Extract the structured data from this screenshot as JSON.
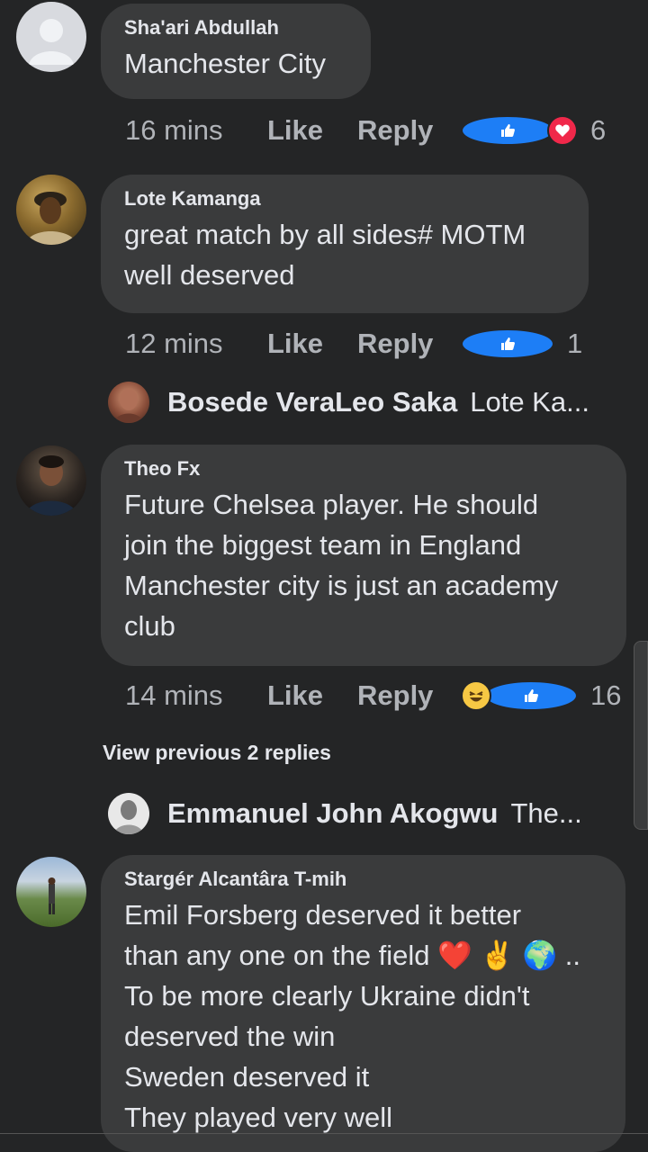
{
  "comments": [
    {
      "author": "Sha'ari Abdullah",
      "text_lines": [
        "Manchester City"
      ],
      "time": "16 mins",
      "like_label": "Like",
      "reply_label": "Reply",
      "reactions": [
        "like-icon",
        "love-icon"
      ],
      "reaction_count": "6"
    },
    {
      "author": "Lote Kamanga",
      "text_lines": [
        "great match by all sides# MOTM",
        "well deserved"
      ],
      "time": "12 mins",
      "like_label": "Like",
      "reply_label": "Reply",
      "reactions": [
        "like-icon"
      ],
      "reaction_count": "1",
      "reply_preview": {
        "author": "Bosede VeraLeo Saka",
        "text": "Lote Ka..."
      }
    },
    {
      "author": "Theo Fx",
      "text_lines": [
        "Future Chelsea player. He should",
        "join the biggest team in England",
        "Manchester city is just an academy",
        "club"
      ],
      "time": "14 mins",
      "like_label": "Like",
      "reply_label": "Reply",
      "reactions": [
        "haha-icon",
        "like-icon"
      ],
      "reaction_count": "16",
      "view_previous": "View previous 2 replies",
      "reply_preview": {
        "author": "Emmanuel John Akogwu",
        "text": "The..."
      }
    },
    {
      "author": "Stargér Alcantâra T-mih",
      "text_lines": [
        "Emil Forsberg deserved it better",
        "than any one on the field ❤️ ✌️ 🌍 ..",
        "To be more clearly Ukraine didn't",
        "deserved the win",
        "Sweden deserved it",
        "They played very well"
      ]
    }
  ],
  "colors": {
    "background": "#242526",
    "bubble": "#3a3b3c",
    "like_blue": "#1d7ef6",
    "love_red": "#f0284a",
    "haha_yellow": "#f7c844"
  }
}
